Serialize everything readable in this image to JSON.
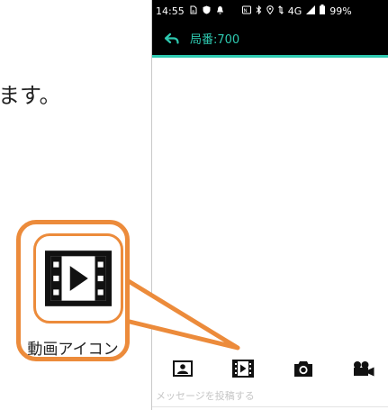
{
  "document": {
    "fragment_text": "ます。"
  },
  "status_bar": {
    "time": "14:55",
    "network": "4G",
    "battery": "99%"
  },
  "app_bar": {
    "title": "局番:700"
  },
  "attach_bar": {
    "icons": [
      "image-icon",
      "video-icon",
      "camera-icon",
      "video-camera-icon"
    ]
  },
  "message_input": {
    "placeholder": "メッセージを投稿する"
  },
  "callout": {
    "label": "動画アイコン"
  },
  "colors": {
    "accent": "#2ec9b0",
    "callout": "#ec8b3b",
    "status_bar_bg": "#000000"
  }
}
